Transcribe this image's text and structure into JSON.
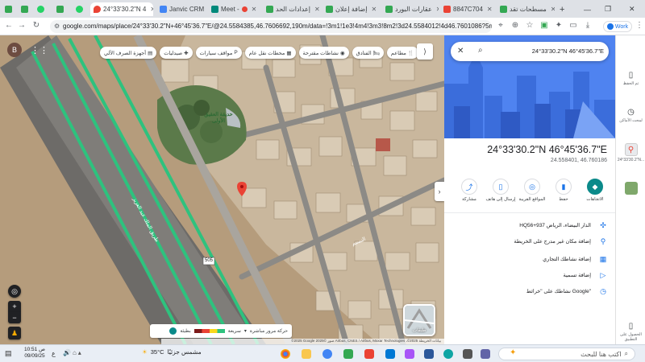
{
  "tabs": [
    {
      "label": "",
      "color": "#34a853"
    },
    {
      "label": "",
      "color": "#34a853"
    },
    {
      "label": "",
      "color": "#25d366"
    },
    {
      "label": "24°33'30.2\"N 4",
      "color": "#ea4335",
      "active": true
    },
    {
      "label": "Janvic CRM",
      "color": "#4285f4"
    },
    {
      "label": "Meet -",
      "color": "#00897b"
    },
    {
      "label": "إعدادات الحد",
      "color": "#34a853"
    },
    {
      "label": "إضافة إعلان",
      "color": "#34a853"
    },
    {
      "label": "عقارات البورد",
      "color": "#34a853"
    },
    {
      "label": "8847C704",
      "color": "#ea4335"
    },
    {
      "label": "مسطحات تقد",
      "color": "#34a853"
    }
  ],
  "address_bar": {
    "url": "google.com/maps/place/24°33'30.2\"N+46°45'36.7\"E/@24.5584385,46.7606692,190m/data=!3m1!1e3!4m4!3m3!8m2!3d24.5584012!4d46.7601086?5m1!1e1!entry..."
  },
  "profile": {
    "initial": "B",
    "work_label": "Work"
  },
  "map": {
    "chips": [
      {
        "label": "مطاعم",
        "icon": "fork-knife-icon"
      },
      {
        "label": "الفنادق",
        "icon": "bed-icon"
      },
      {
        "label": "نشاطات مقترحة",
        "icon": "camera-icon"
      },
      {
        "label": "محطات نقل عام",
        "icon": "bus-icon"
      },
      {
        "label": "مواقف سيارات",
        "icon": "parking-icon"
      },
      {
        "label": "صيدليات",
        "icon": "pharmacy-icon"
      },
      {
        "label": "أجهزة الصرف الآلي",
        "icon": "atm-icon"
      }
    ],
    "park_label": "حديقة العقيق الأولى",
    "road_label": "طريق الملك عبد العزيز",
    "street_label": "النسيم",
    "road_badge": "505",
    "layers_label": "طبقات",
    "traffic": {
      "fast": "سريعة",
      "slow": "بطيئة",
      "mode": "حركة مرور مباشرة"
    },
    "attribution": "©2025 Google صور ©2025 Airbus, CNES / Airbus, Maxar Technologies ،©2025 بيانات الخريطة"
  },
  "panel": {
    "search_value": "24°33'30.2\"N 46°45'36.7\"E",
    "title": "24°33'30.2\"N 46°45'36.7\"E",
    "decimal": "24.558401, 46.760186",
    "actions": [
      {
        "label": "الاتجاهات",
        "icon": "directions-icon"
      },
      {
        "label": "حفظ",
        "icon": "bookmark-icon"
      },
      {
        "label": "المواقع القريبة",
        "icon": "nearby-icon"
      },
      {
        "label": "إرسال إلى هاتف",
        "icon": "phone-icon"
      },
      {
        "label": "مشاركة",
        "icon": "share-icon"
      }
    ],
    "info": [
      {
        "text": "HQ56+937 الدار البيضاء، الرياض",
        "icon": "plus-code-icon"
      },
      {
        "text": "إضافة مكان غير مدرج على الخريطة",
        "icon": "add-place-icon"
      },
      {
        "text": "إضافة نشاطك التجاري",
        "icon": "store-icon"
      },
      {
        "text": "إضافة تسمية",
        "icon": "label-icon"
      },
      {
        "text": "نشاطك على \"خرائط Google\"",
        "icon": "history-icon"
      }
    ]
  },
  "rail": [
    {
      "label": "تم الحفظ",
      "icon": "bookmark-icon"
    },
    {
      "label": "لمحت الأماكن",
      "icon": "history-icon"
    },
    {
      "label": "24°33'30.2\"N...",
      "icon": "pin-icon"
    },
    {
      "label": "",
      "icon": "map-thumb-icon"
    },
    {
      "label": "الحصول على التطبيق",
      "icon": "phone-icon"
    }
  ],
  "taskbar": {
    "date": "09/09/25",
    "time": "10:51 ص",
    "weather_temp": "35°C",
    "weather_text": "مشمس جزئيًا",
    "search_placeholder": "اكتب هنا للبحث",
    "lang": "ع"
  }
}
